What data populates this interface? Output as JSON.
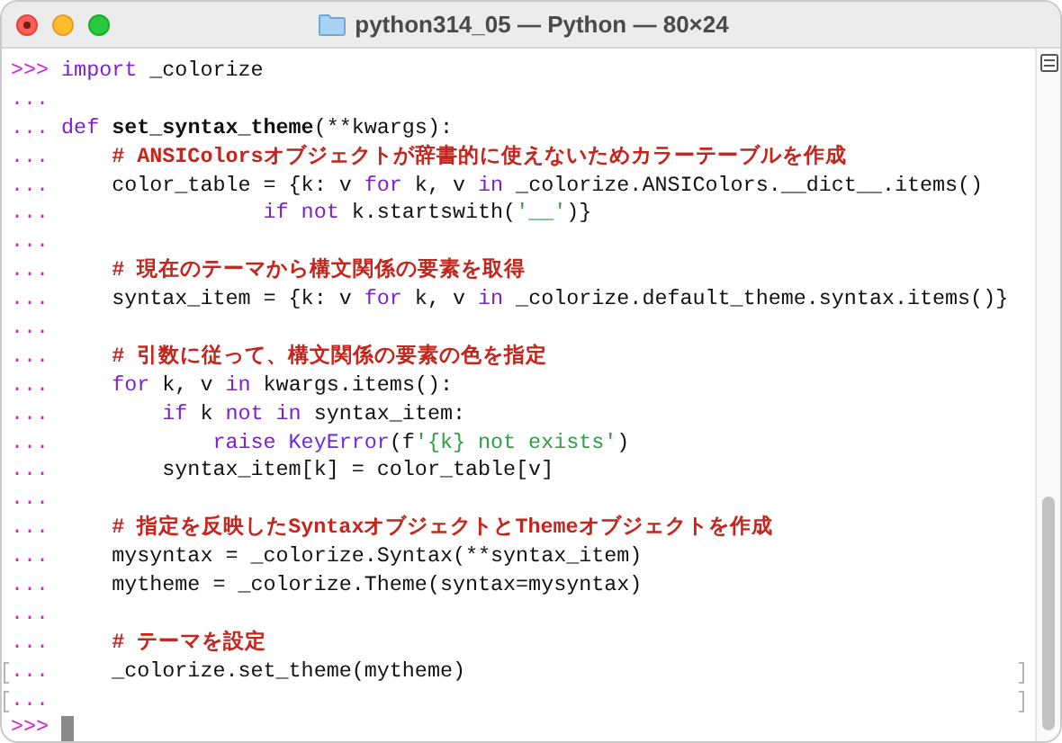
{
  "window": {
    "title": "python314_05 — Python — 80×24"
  },
  "terminal": {
    "lines": [
      {
        "prompt": ">>>",
        "segments": [
          {
            "kind": "keyword",
            "text": "import"
          },
          {
            "kind": "plain",
            "text": " _colorize"
          }
        ]
      },
      {
        "prompt": "..."
      },
      {
        "prompt": "...",
        "segments": [
          {
            "kind": "keyword",
            "text": "def"
          },
          {
            "kind": "funcname",
            "text": " set_syntax_theme"
          },
          {
            "kind": "plain",
            "text": "(**kwargs):"
          }
        ]
      },
      {
        "prompt": "...",
        "segments": [
          {
            "kind": "comment",
            "text": "    # ANSIColorsオブジェクトが辞書的に使えないためカラーテーブルを作成"
          }
        ]
      },
      {
        "prompt": "...",
        "segments": [
          {
            "kind": "plain",
            "text": "    color_table = {k: v "
          },
          {
            "kind": "keyword",
            "text": "for"
          },
          {
            "kind": "plain",
            "text": " k, v "
          },
          {
            "kind": "keyword",
            "text": "in"
          },
          {
            "kind": "plain",
            "text": " _colorize.ANSIColors.__dict__.items()"
          }
        ]
      },
      {
        "prompt": "...",
        "segments": [
          {
            "kind": "keyword",
            "text": "                if not"
          },
          {
            "kind": "plain",
            "text": " k.startswith("
          },
          {
            "kind": "string",
            "text": "'__'"
          },
          {
            "kind": "plain",
            "text": ")}"
          }
        ]
      },
      {
        "prompt": "..."
      },
      {
        "prompt": "...",
        "segments": [
          {
            "kind": "comment",
            "text": "    # 現在のテーマから構文関係の要素を取得"
          }
        ]
      },
      {
        "prompt": "...",
        "segments": [
          {
            "kind": "plain",
            "text": "    syntax_item = {k: v "
          },
          {
            "kind": "keyword",
            "text": "for"
          },
          {
            "kind": "plain",
            "text": " k, v "
          },
          {
            "kind": "keyword",
            "text": "in"
          },
          {
            "kind": "plain",
            "text": " _colorize.default_theme.syntax.items()}"
          }
        ]
      },
      {
        "prompt": "..."
      },
      {
        "prompt": "...",
        "segments": [
          {
            "kind": "comment",
            "text": "    # 引数に従って、構文関係の要素の色を指定"
          }
        ]
      },
      {
        "prompt": "...",
        "segments": [
          {
            "kind": "keyword",
            "text": "    for"
          },
          {
            "kind": "plain",
            "text": " k, v "
          },
          {
            "kind": "keyword",
            "text": "in"
          },
          {
            "kind": "plain",
            "text": " kwargs.items():"
          }
        ]
      },
      {
        "prompt": "...",
        "segments": [
          {
            "kind": "keyword",
            "text": "        if"
          },
          {
            "kind": "plain",
            "text": " k "
          },
          {
            "kind": "keyword",
            "text": "not in"
          },
          {
            "kind": "plain",
            "text": " syntax_item:"
          }
        ]
      },
      {
        "prompt": "...",
        "segments": [
          {
            "kind": "keyword",
            "text": "            raise "
          },
          {
            "kind": "builtin",
            "text": "KeyError"
          },
          {
            "kind": "plain",
            "text": "(f"
          },
          {
            "kind": "string",
            "text": "'{k} not exists'"
          },
          {
            "kind": "plain",
            "text": ")"
          }
        ]
      },
      {
        "prompt": "...",
        "segments": [
          {
            "kind": "plain",
            "text": "        syntax_item[k] = color_table[v]"
          }
        ]
      },
      {
        "prompt": "..."
      },
      {
        "prompt": "...",
        "segments": [
          {
            "kind": "comment",
            "text": "    # 指定を反映したSyntaxオブジェクトとThemeオブジェクトを作成"
          }
        ]
      },
      {
        "prompt": "...",
        "segments": [
          {
            "kind": "plain",
            "text": "    mysyntax = _colorize.Syntax(**syntax_item)"
          }
        ]
      },
      {
        "prompt": "...",
        "segments": [
          {
            "kind": "plain",
            "text": "    mytheme = _colorize.Theme(syntax=mysyntax)"
          }
        ]
      },
      {
        "prompt": "..."
      },
      {
        "prompt": "...",
        "segments": [
          {
            "kind": "comment",
            "text": "    # テーマを設定"
          }
        ]
      },
      {
        "prompt": "...",
        "marked": true,
        "segments": [
          {
            "kind": "plain",
            "text": "    _colorize.set_theme(mytheme)"
          }
        ]
      },
      {
        "prompt": "...",
        "marked": true
      },
      {
        "prompt": ">>>",
        "cursor": true
      }
    ]
  }
}
